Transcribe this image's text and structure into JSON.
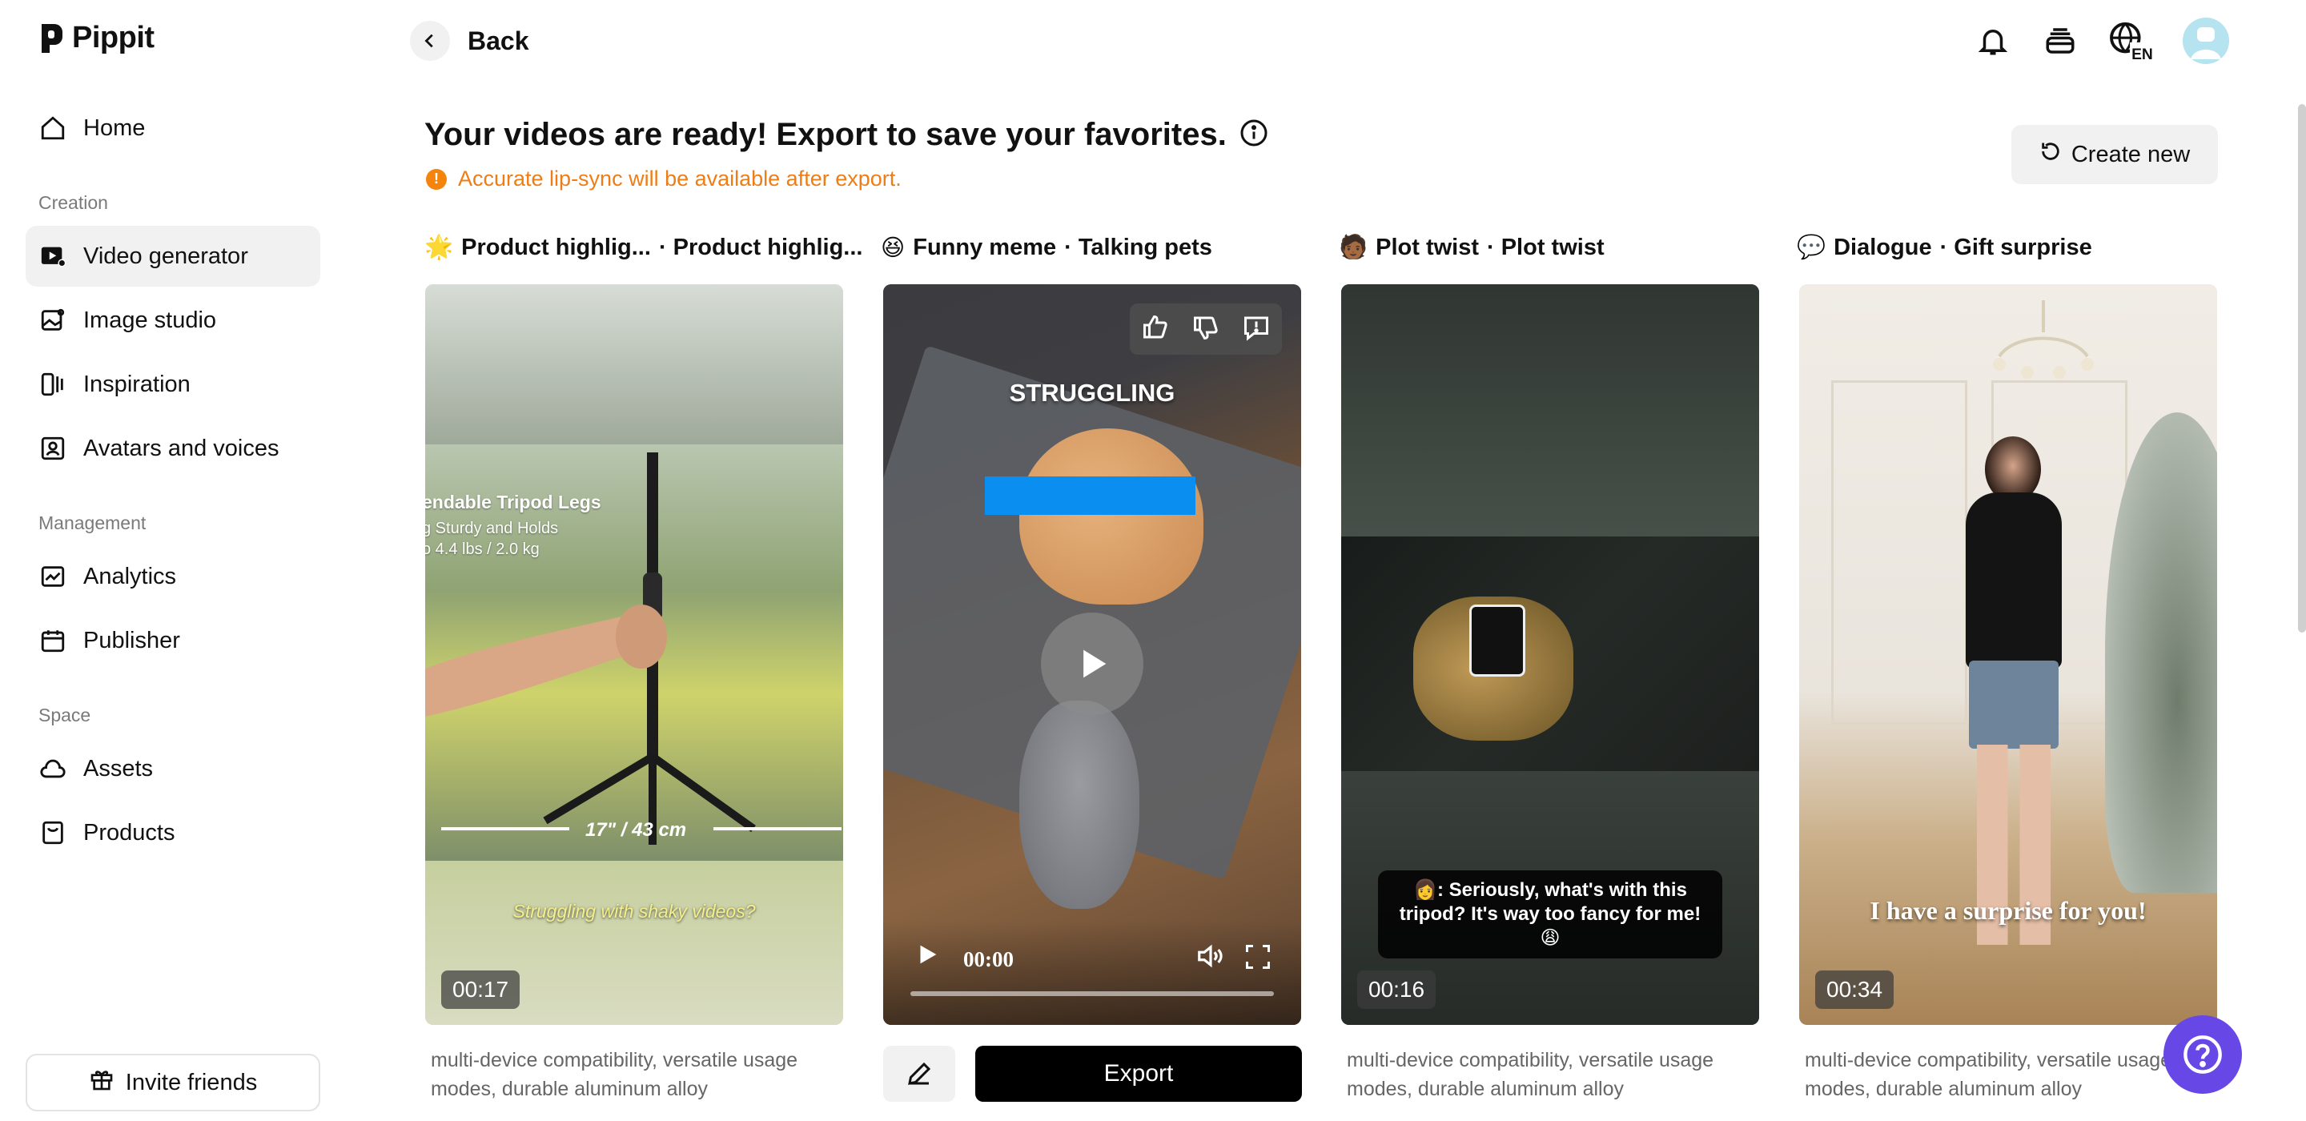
{
  "app": {
    "name": "Pippit"
  },
  "sidebar": {
    "items_top": [
      {
        "label": "Home",
        "icon": "home-icon"
      }
    ],
    "sections": [
      {
        "title": "Creation",
        "items": [
          {
            "label": "Video generator",
            "icon": "video-generator-icon",
            "active": true
          },
          {
            "label": "Image studio",
            "icon": "image-studio-icon"
          },
          {
            "label": "Inspiration",
            "icon": "inspiration-icon"
          },
          {
            "label": "Avatars and voices",
            "icon": "avatar-icon"
          }
        ]
      },
      {
        "title": "Management",
        "items": [
          {
            "label": "Analytics",
            "icon": "analytics-icon"
          },
          {
            "label": "Publisher",
            "icon": "calendar-icon"
          }
        ]
      },
      {
        "title": "Space",
        "items": [
          {
            "label": "Assets",
            "icon": "cloud-icon"
          },
          {
            "label": "Products",
            "icon": "product-box-icon"
          }
        ]
      }
    ],
    "invite_label": "Invite friends"
  },
  "topbar": {
    "back_label": "Back",
    "language": "EN"
  },
  "header": {
    "title": "Your videos are ready! Export to save your favorites.",
    "notice": "Accurate lip-sync will be available after export.",
    "create_new": "Create new"
  },
  "cards": [
    {
      "emoji": "🌟",
      "category": "Product highlig...",
      "style": "· Product highlig...",
      "duration": "00:17",
      "overlay_title": "endable Tripod Legs",
      "overlay_sub1": "g Sturdy and Holds",
      "overlay_sub2": "o 4.4 lbs / 2.0 kg",
      "measure": "17\" / 43 cm",
      "caption": "Struggling with shaky videos?",
      "description": "multi-device compatibility, versatile usage modes, durable aluminum alloy"
    },
    {
      "emoji": "😆",
      "category": "Funny meme",
      "style": "· Talking pets",
      "overlay_text": "STRUGGLING",
      "current_time": "00:00",
      "export_label": "Export"
    },
    {
      "emoji": "🧑🏾",
      "category": "Plot twist",
      "style": "· Plot twist",
      "duration": "00:16",
      "subtitle": "👩: Seriously, what's with this tripod? It's way too fancy for me! 😩",
      "description": "multi-device compatibility, versatile usage modes, durable aluminum alloy"
    },
    {
      "emoji": "💬",
      "category": "Dialogue",
      "style": "· Gift surprise",
      "duration": "00:34",
      "caption": "I have a surprise for you!",
      "description": "multi-device compatibility, versatile usage modes, durable aluminum alloy"
    }
  ],
  "colors": {
    "accent_orange": "#ef7d16",
    "help_purple": "#6747e6",
    "export_black": "#000000",
    "progress_blue": "#0a8ff0"
  }
}
